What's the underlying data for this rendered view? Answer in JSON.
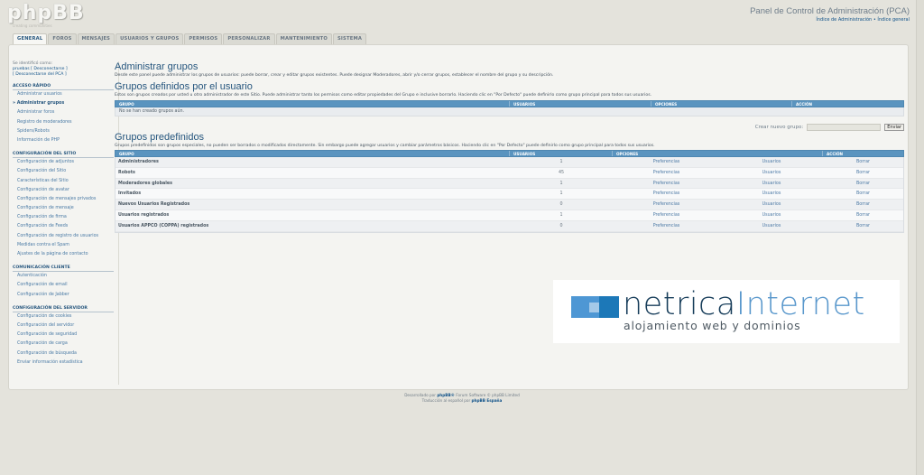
{
  "logo": {
    "text": "phpBB",
    "tagline": "creating communities"
  },
  "header": {
    "title": "Panel de Control de Administración (PCA)",
    "link_index_admin": "Índice de Administración",
    "link_sep": " • ",
    "link_index_general": "Índice general"
  },
  "tabs": [
    {
      "label": "GENERAL",
      "active": true
    },
    {
      "label": "FOROS"
    },
    {
      "label": "MENSAJES"
    },
    {
      "label": "USUARIOS Y GRUPOS"
    },
    {
      "label": "PERMISOS"
    },
    {
      "label": "PERSONALIZAR"
    },
    {
      "label": "MANTENIMIENTO"
    },
    {
      "label": "SISTEMA"
    }
  ],
  "sidebar": {
    "ident_line1": "Se identificó como:",
    "ident_user": "pruebas",
    "ident_logout": "[ Desconectarse ]",
    "ident_logout_pca": "[ Desconectarse del PCA ]",
    "sections": [
      {
        "title": "ACCESO RÁPIDO",
        "items": [
          "Administrar usuarios",
          "» Administrar grupos",
          "Administrar foros",
          "Registro de moderadores",
          "Spiders/Robots",
          "Información de PHP"
        ]
      },
      {
        "title": "CONFIGURACIÓN DEL SITIO",
        "items": [
          "Configuración de adjuntos",
          "Configuración del Sitio",
          "Características del Sitio",
          "Configuración de avatar",
          "Configuración de mensajes privados",
          "Configuración de mensaje",
          "Configuración de firma",
          "Configuración de Feeds",
          "Configuración de registro de usuarios",
          "Medidas contra el Spam",
          "Ajustes de la página de contacto"
        ]
      },
      {
        "title": "COMUNICACIÓN CLIENTE",
        "items": [
          "Autenticación",
          "Configuración de email",
          "Configuración de Jabber"
        ]
      },
      {
        "title": "CONFIGURACIÓN DEL SERVIDOR",
        "items": [
          "Configuración de cookies",
          "Configuración del servidor",
          "Configuración de seguridad",
          "Configuración de carga",
          "Configuración de búsqueda",
          "Enviar información estadística"
        ]
      }
    ]
  },
  "main": {
    "title": "Administrar grupos",
    "desc": "Desde este panel puede administrar los grupos de usuarios: puede borrar, crear y editar grupos existentes. Puede designar Moderadores, abrir y/o cerrar grupos, establecer el nombre del grupo y su descripción.",
    "user_groups": {
      "title": "Grupos definidos por el usuario",
      "desc": "Estos son grupos creados por usted u otro administrador de este Sitio. Puede administrar tanto los permisos como editar propiedades del Grupo e inclusive borrarlo. Haciendo clic en \"Por Defecto\" puede definirlo como grupo principal para todos sus usuarios.",
      "headers": [
        "GRUPO",
        "USUARIOS",
        "OPCIONES",
        "ACCIÓN"
      ],
      "empty": "No se han creado grupos aún.",
      "new_label": "Crear nuevo grupo:",
      "new_value": "",
      "submit": "Enviar"
    },
    "predefined": {
      "title": "Grupos predefinidos",
      "desc": "Grupos predefinidos son grupos especiales, no pueden ser borrados o modificados directamente. Sin embargo puede agregar usuarios y cambiar parámetros básicos. Haciendo clic en \"Por Defecto\" puede definirlo como grupo principal para todos sus usuarios.",
      "headers": [
        "GRUPO",
        "USUARIOS",
        "OPCIONES",
        "ACCIÓN"
      ],
      "rows": [
        {
          "name": "Administradores",
          "users": "1",
          "pref": "Preferencias",
          "usuarios": "Usuarios",
          "action": "Borrar"
        },
        {
          "name": "Robots",
          "users": "45",
          "pref": "Preferencias",
          "usuarios": "Usuarios",
          "action": "Borrar"
        },
        {
          "name": "Moderadores globales",
          "users": "1",
          "pref": "Preferencias",
          "usuarios": "Usuarios",
          "action": "Borrar"
        },
        {
          "name": "Invitados",
          "users": "1",
          "pref": "Preferencias",
          "usuarios": "Usuarios",
          "action": "Borrar"
        },
        {
          "name": "Nuevos Usuarios Registrados",
          "users": "0",
          "pref": "Preferencias",
          "usuarios": "Usuarios",
          "action": "Borrar"
        },
        {
          "name": "Usuarios registrados",
          "users": "1",
          "pref": "Preferencias",
          "usuarios": "Usuarios",
          "action": "Borrar"
        },
        {
          "name": "Usuarios APPCO (COPPA) registrados",
          "users": "0",
          "pref": "Preferencias",
          "usuarios": "Usuarios",
          "action": "Borrar"
        }
      ]
    }
  },
  "promo": {
    "brand_a": "netrica",
    "brand_b": "Internet",
    "tagline": "alojamiento web y dominios"
  },
  "footer": {
    "line1_a": "Desarrollado por",
    "line1_b": "phpBB®",
    "line1_c": "Forum Software © phpBB Limited",
    "line2_a": "Traducción al español por",
    "line2_b": "phpBB España"
  }
}
